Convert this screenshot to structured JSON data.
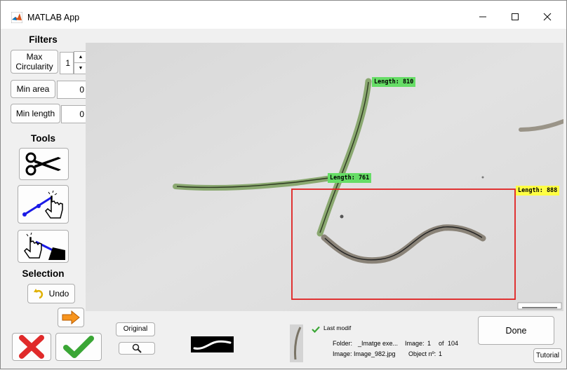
{
  "window": {
    "title": "MATLAB App",
    "minimize_icon": "minimize-icon",
    "maximize_icon": "maximize-icon",
    "close_icon": "close-icon"
  },
  "filters": {
    "heading": "Filters",
    "max_circularity": {
      "label": "Max Circularity",
      "value": "1"
    },
    "min_area": {
      "label": "Min area",
      "value": "0"
    },
    "min_length": {
      "label": "Min length",
      "value": "0"
    }
  },
  "tools": {
    "heading": "Tools",
    "cut_icon": "scissors-icon",
    "draw_line_icon": "draw-line-hand-icon",
    "erase_icon": "erase-hand-icon"
  },
  "selection": {
    "heading": "Selection",
    "undo_label": "Undo",
    "next_icon": "arrow-right-icon"
  },
  "image_view": {
    "labels": [
      {
        "text": "Length: 810",
        "color": "#66dd66"
      },
      {
        "text": "Length: 761",
        "color": "#66dd66"
      },
      {
        "text": "Length: 888",
        "color": "#ffff44"
      }
    ],
    "selection_box_color": "#e02020"
  },
  "bottom": {
    "reject_icon": "red-x-icon",
    "accept_icon": "green-check-icon",
    "original_label": "Original",
    "zoom_icon": "magnifier-icon",
    "last_modif": "Last modif",
    "folder_label": "Folder:",
    "folder_value": "_Imatge exe...",
    "image_label": "Image:",
    "image_value": "Image_982.jpg",
    "image_index_label": "Image:",
    "image_index": "1",
    "of_label": "of",
    "image_total": "104",
    "object_label": "Object nº:",
    "object_value": "1",
    "done_label": "Done",
    "tutorial_label": "Tutorial"
  }
}
